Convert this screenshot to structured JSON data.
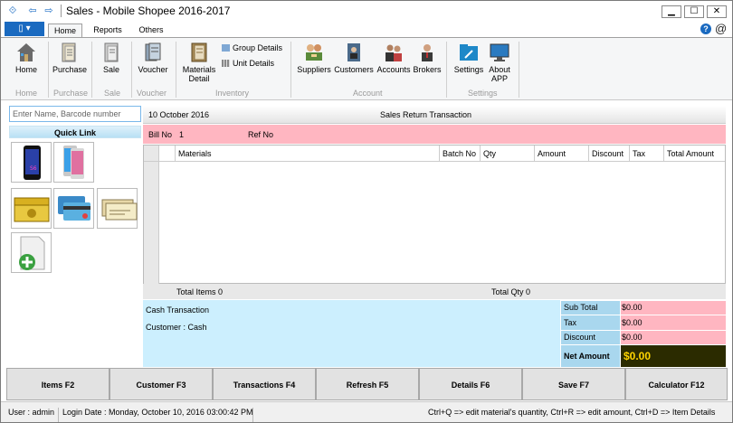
{
  "window": {
    "title": "Sales - Mobile Shopee 2016-2017",
    "controls": {
      "minimize": "▁",
      "maximize": "☐",
      "close": "✕"
    }
  },
  "ribbon": {
    "file_label": "▾",
    "tabs": [
      "Home",
      "Reports",
      "Others"
    ],
    "help_icon": "?",
    "at_symbol": "@",
    "buttons": {
      "home": "Home",
      "purchase": "Purchase",
      "sale": "Sale",
      "voucher": "Voucher",
      "materials_detail": "Materials Detail",
      "group_details": "Group Details",
      "unit_details": "Unit Details",
      "suppliers": "Suppliers",
      "customers": "Customers",
      "accounts": "Accounts",
      "brokers": "Brokers",
      "settings": "Settings",
      "about_app": "About APP"
    },
    "groups": {
      "home": "Home",
      "purchase": "Purchase",
      "sale": "Sale",
      "voucher": "Voucher",
      "inventory": "Inventory",
      "account": "Account",
      "settings": "Settings"
    }
  },
  "left_panel": {
    "search_placeholder": "Enter Name, Barcode number",
    "quick_link": "Quick Link",
    "icons": [
      "phone-s6-icon",
      "phone-iphone-icon",
      "cash-icon",
      "credit-card-icon",
      "cheque-icon",
      "add-document-icon"
    ]
  },
  "transaction": {
    "date": "10 October 2016",
    "title": "Sales Return Transaction",
    "bill_no_label": "Bill No",
    "bill_no": "1",
    "ref_no_label": "Ref No",
    "columns": [
      "Materials",
      "Batch No",
      "Qty",
      "Amount",
      "Discount",
      "Tax",
      "Total Amount"
    ],
    "total_items": "Total Items 0",
    "total_qty": "Total Qty 0"
  },
  "customer_panel": {
    "line1": "Cash Transaction",
    "line2": "Customer :  Cash"
  },
  "summary": {
    "sub_total_label": "Sub Total",
    "sub_total": "$0.00",
    "tax_label": "Tax",
    "tax": "$0.00",
    "discount_label": "Discount",
    "discount": "$0.00",
    "net_amount_label": "Net Amount",
    "net_amount": "$0.00"
  },
  "function_buttons": [
    "Items F2",
    "Customer F3",
    "Transactions F4",
    "Refresh F5",
    "Details F6",
    "Save F7",
    "Calculator F12"
  ],
  "status": {
    "user": "User : admin",
    "login_date": "Login Date : Monday, October 10, 2016 03:00:42 PM",
    "shortcuts": "Ctrl+Q => edit material's quantity, Ctrl+R => edit amount, Ctrl+D => Item Details"
  },
  "colors": {
    "accent": "#1a6ac0",
    "bill_row": "#ffb6c1",
    "customer_panel": "#cceffe",
    "net_amount_bg": "#2b2b00",
    "net_amount_fg": "#ffd400"
  }
}
